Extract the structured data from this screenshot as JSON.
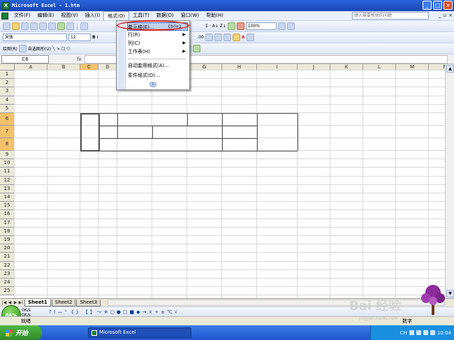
{
  "window": {
    "title": "Microsoft Excel - 1.htm",
    "app_icon_letter": "X"
  },
  "menu": {
    "items": [
      "文件(F)",
      "编辑(E)",
      "视图(V)",
      "插入(I)",
      "格式(O)",
      "工具(T)",
      "数据(D)",
      "窗口(W)",
      "帮助(H)"
    ],
    "active_index": 4,
    "help_placeholder": "键入需要帮助的问题"
  },
  "format_menu": {
    "items": [
      {
        "label": "单元格(E)...",
        "shortcut": "Ctrl+1",
        "submenu": false,
        "highlighted": true
      },
      {
        "label": "行(R)",
        "shortcut": "",
        "submenu": true,
        "highlighted": false
      },
      {
        "label": "列(C)",
        "shortcut": "",
        "submenu": true,
        "highlighted": false
      },
      {
        "label": "工作表(H)",
        "shortcut": "",
        "submenu": true,
        "highlighted": false
      },
      {
        "label": "自动套用格式(A)...",
        "shortcut": "",
        "submenu": false,
        "highlighted": false
      },
      {
        "label": "条件格式(D)...",
        "shortcut": "",
        "submenu": false,
        "highlighted": false
      }
    ],
    "more_symbol": "»"
  },
  "toolbar": {
    "font_name": "宋体",
    "font_size": "12",
    "zoom": "100%",
    "draw_label": "绘图(R)",
    "autoshape_label": "自选图形(U)"
  },
  "formula": {
    "name_box": "C6",
    "fx": "fx"
  },
  "columns": [
    "A",
    "B",
    "C",
    "D",
    "E",
    "F",
    "G",
    "H",
    "I",
    "J",
    "K",
    "L",
    "M",
    "N"
  ],
  "selected_col": "C",
  "rows": [
    "1",
    "2",
    "3",
    "4",
    "5",
    "6",
    "7",
    "8",
    "9",
    "10",
    "11",
    "12",
    "13",
    "14",
    "15",
    "16",
    "17",
    "18",
    "19",
    "20",
    "21",
    "22",
    "23",
    "24",
    "25"
  ],
  "selected_rows": [
    "6",
    "7",
    "8"
  ],
  "sheets": {
    "tabs": [
      "Sheet1",
      "Sheet2",
      "Sheet3"
    ],
    "active_index": 0
  },
  "status": {
    "left": "就绪",
    "right": "数字"
  },
  "gauge": {
    "percent": "86%",
    "up": "0K/s",
    "down": "0K/s"
  },
  "taskbar": {
    "start": "开始",
    "item": "Microsoft Excel",
    "clock": "10:04",
    "lang": "CH"
  },
  "watermark": {
    "brand": "Bai 经验",
    "url": "jingyan.baidu.com"
  }
}
